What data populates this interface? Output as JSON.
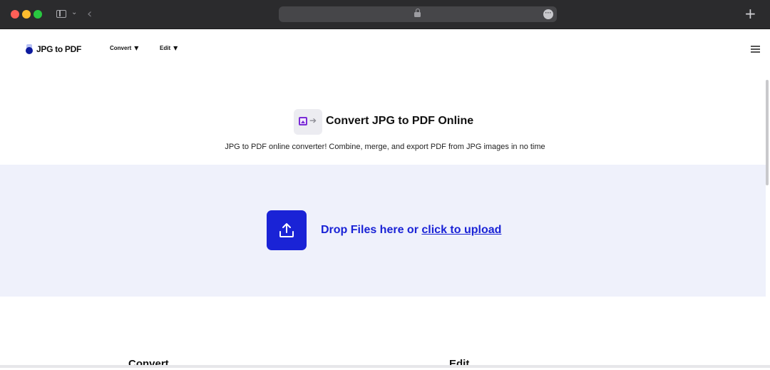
{
  "browser": {
    "buttons": {
      "sidebar": "sidebar-toggle",
      "back": "‹",
      "new_tab": "+",
      "more": "•••"
    }
  },
  "header": {
    "logo_text": "JPG to PDF",
    "nav": [
      {
        "label": "Convert",
        "caret": "▼"
      },
      {
        "label": "Edit",
        "caret": "▼"
      }
    ]
  },
  "hero": {
    "title": "Convert JPG to PDF Online",
    "subtitle": "JPG to PDF online converter! Combine, merge, and export PDF from JPG images in no time"
  },
  "upload": {
    "prompt": "Drop Files here or",
    "link": "click to upload"
  },
  "footer": {
    "convert_heading": "Convert",
    "edit_heading": "Edit"
  },
  "colors": {
    "accent": "#1a23d6",
    "upload_bg": "#eff1fb",
    "chrome_bg": "#2b2b2d"
  }
}
